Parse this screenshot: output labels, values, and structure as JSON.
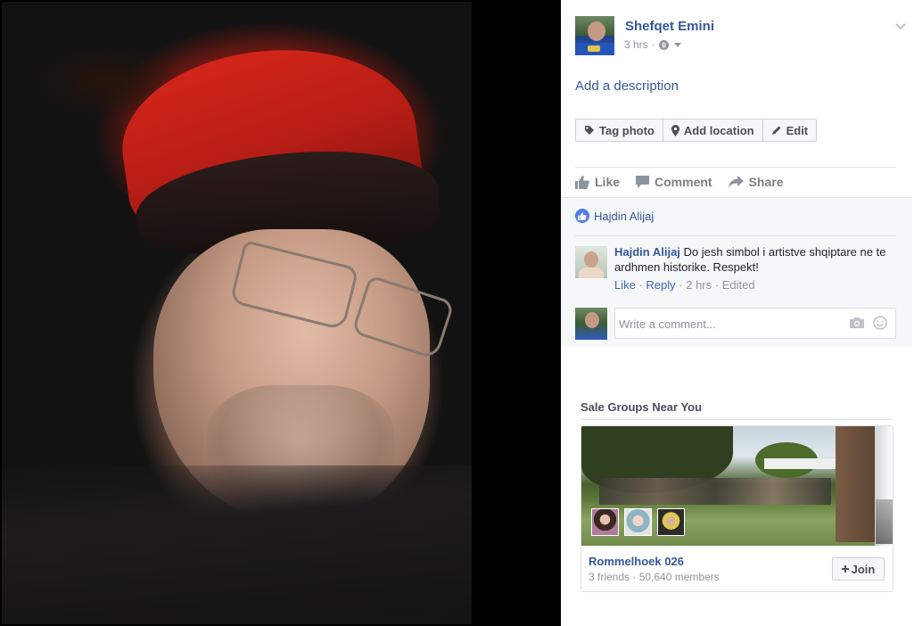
{
  "post": {
    "author": "Shefqet Emini",
    "time": "3 hrs",
    "separator": "·",
    "add_description": "Add a description"
  },
  "photo_tools": {
    "tag_photo": "Tag photo",
    "add_location": "Add location",
    "edit": "Edit"
  },
  "actions": {
    "like": "Like",
    "comment": "Comment",
    "share": "Share"
  },
  "reactions": {
    "liked_by": "Hajdin Alijaj"
  },
  "comment": {
    "author": "Hajdin Alijaj",
    "text": "Do jesh simbol i artistve shqiptare ne te ardhmen historike. Respekt!",
    "like": "Like",
    "reply": "Reply",
    "time": "2 hrs",
    "edited": "Edited",
    "sep": " · "
  },
  "composer": {
    "placeholder": "Write a comment..."
  },
  "sale_groups": {
    "title": "Sale Groups Near You",
    "group_name": "Rommelhoek 026",
    "friends": "3 friends",
    "members": "50,640 members",
    "join": "Join"
  },
  "colors": {
    "link_blue": "#365899",
    "like_blue": "#4f7ee8",
    "muted_gray": "#90949c"
  }
}
